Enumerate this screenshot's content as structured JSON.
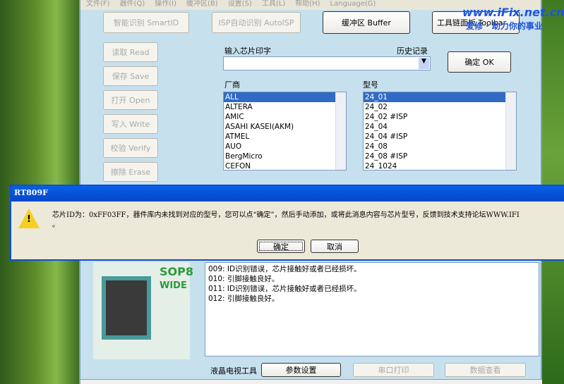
{
  "menu": [
    "文件(F)",
    "器件(Q)",
    "操作(I)",
    "缓冲区(B)",
    "设置(S)",
    "工具(L)",
    "帮助(H)",
    "Language(G)"
  ],
  "toolbar": {
    "smartid": "智能识别 SmartID",
    "autoisp": "ISP自动识别 AutoISP",
    "buffer": "缓冲区 Buffer",
    "tools": "工具链面板 Toolbar"
  },
  "watermark": {
    "url": "www.iFix.net.cn",
    "slogan": "爱修 · 助力你的事业"
  },
  "side": [
    "读取 Read",
    "保存 Save",
    "打开 Open",
    "写入 Write",
    "校验 Verify",
    "擦除 Erase"
  ],
  "chip": {
    "input_label": "输入芯片印字",
    "history_label": "历史记录",
    "input_value": "",
    "ok": "确定 OK",
    "vendor_label": "厂商",
    "model_label": "型号"
  },
  "vendors": [
    "ALL",
    "ALTERA",
    "AMIC",
    "ASAHI KASEI(AKM)",
    "ATMEL",
    "AUO",
    "BergMicro",
    "CEFON"
  ],
  "models": [
    "24_01",
    "24_02",
    "24_02 #ISP",
    "24_04",
    "24_04 #ISP",
    "24_08",
    "24_08 #ISP",
    "24_1024"
  ],
  "dialog": {
    "title": "RT809F",
    "message": "芯片ID为：0xFF03FF，器件库内未找到对应的型号，您可以点“确定”，然后手动添加，或将此消息内容与芯片型号，反馈到技术支持论坛WWW.IFI",
    "message2": "。",
    "ok": "确定",
    "cancel": "取消"
  },
  "socket": {
    "line1": "SOP8",
    "line2": "WIDE"
  },
  "log": [
    "009: ID识别错误，芯片接触好或者已经损坏。",
    "010: 引脚接触良好。",
    "011: ID识别错误，芯片接触好或者已经损坏。",
    "012: 引脚接触良好。"
  ],
  "bottom": {
    "lcd_label": "液晶电视工具",
    "params": "参数设置",
    "serial": "串口打印",
    "data": "数据查看"
  }
}
